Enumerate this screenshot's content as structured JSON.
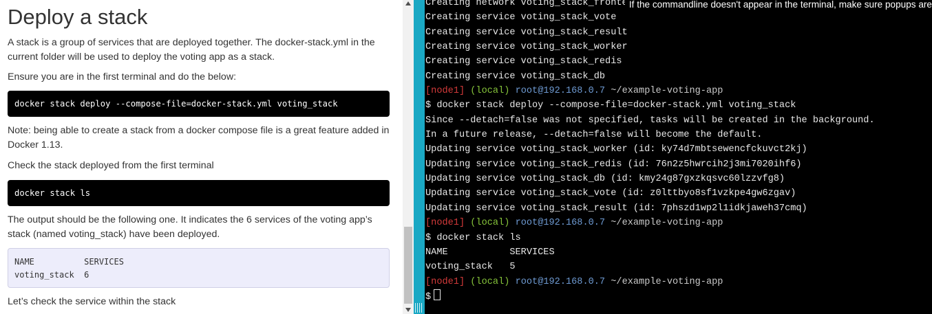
{
  "tutorial": {
    "title": "Deploy a stack",
    "intro": "A stack is a group of services that are deployed together. The docker-stack.yml in the current folder will be used to deploy the voting app as a stack.",
    "ensure": "Ensure you are in the first terminal and do the below:",
    "deploy_command": "docker stack deploy --compose-file=docker-stack.yml voting_stack",
    "note": "Note: being able to create a stack from a docker compose file is a great feature added in Docker 1.13.",
    "check_text": "Check the stack deployed from the first terminal",
    "ls_command": "docker stack ls",
    "output_text": "The output should be the following one. It indicates the 6 services of the voting app’s stack (named voting_stack) have been deployed.",
    "output_table": {
      "header": "NAME          SERVICES",
      "row": "voting_stack  6"
    },
    "next_text": "Let’s check the service within the stack"
  },
  "terminal": {
    "notice": "If the commandline doesn't appear in the terminal, make sure popups are",
    "prompt": {
      "node": "[node1]",
      "location": "(local)",
      "user_host": "root@192.168.0.7",
      "path": "~/example-voting-app",
      "symbol": "$"
    },
    "lines": {
      "l0": "Creating network voting_stack_frontend",
      "l1": "Creating service voting_stack_vote",
      "l2": "Creating service voting_stack_result",
      "l3": "Creating service voting_stack_worker",
      "l4": "Creating service voting_stack_redis",
      "l5": "Creating service voting_stack_db",
      "l7": "$ docker stack deploy --compose-file=docker-stack.yml voting_stack",
      "l8": "Since --detach=false was not specified, tasks will be created in the background.",
      "l9": "In a future release, --detach=false will become the default.",
      "l10": "Updating service voting_stack_worker (id: ky74d7mbtsewencfckuvct2kj)",
      "l11": "Updating service voting_stack_redis (id: 76n2z5hwrcih2j3mi7020ihf6)",
      "l12": "Updating service voting_stack_db (id: kmy24g87gxzkqsvc60lzzvfg8)",
      "l13": "Updating service voting_stack_vote (id: z0lttbyo8sf1vzkpe4gw6zgav)",
      "l14": "Updating service voting_stack_result (id: 7phszd1wp2l1idkjaweh37cmq)",
      "l16": "$ docker stack ls",
      "l17": "NAME           SERVICES",
      "l18": "voting_stack   5"
    }
  },
  "colors": {
    "divider": "#1aa8c4",
    "prompt_node": "#d33a3a",
    "prompt_local": "#86c43a",
    "prompt_host": "#6e9ad2"
  }
}
